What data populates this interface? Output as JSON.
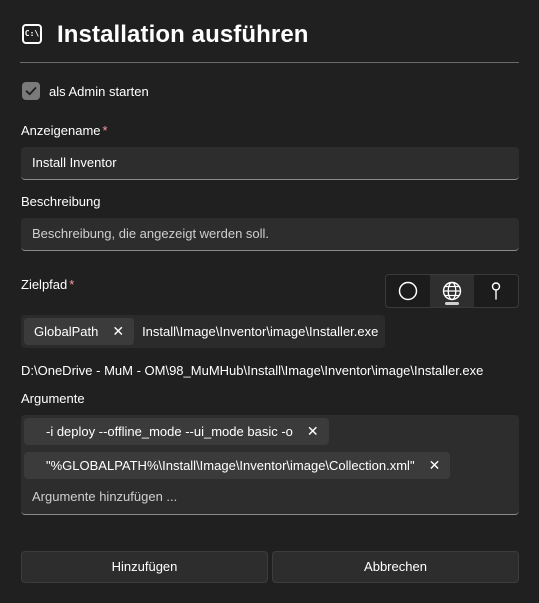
{
  "dialog": {
    "title": "Installation ausführen",
    "title_icon": "command-prompt-icon"
  },
  "admin": {
    "checked": true,
    "label": "als Admin starten"
  },
  "display_name": {
    "label": "Anzeigename",
    "required_mark": "*",
    "value": "Install Inventor"
  },
  "description": {
    "label": "Beschreibung",
    "placeholder": "Beschreibung, die angezeigt werden soll."
  },
  "target_path": {
    "label": "Zielpfad",
    "required_mark": "*",
    "modes": [
      "circle-icon",
      "globe-icon",
      "pin-icon"
    ],
    "selected_mode": "globe-icon",
    "token": "GlobalPath",
    "token_remove": "✕",
    "path_value": "Install\\Image\\Inventor\\image\\Installer.exe",
    "resolved_path": "D:\\OneDrive - MuM - OM\\98_MuMHub\\Install\\Image\\Inventor\\image\\Installer.exe"
  },
  "arguments": {
    "label": "Argumente",
    "items": [
      "-i deploy --offline_mode --ui_mode basic -o",
      "\"%GLOBALPATH%\\Install\\Image\\Inventor\\image\\Collection.xml\""
    ],
    "remove": "✕",
    "placeholder": "Argumente hinzufügen ..."
  },
  "buttons": {
    "add": "Hinzufügen",
    "cancel": "Abbrechen"
  },
  "colors": {
    "background": "#202020",
    "input": "#2d2d2d",
    "token": "#3b3b3b",
    "required": "#ff99a4"
  }
}
